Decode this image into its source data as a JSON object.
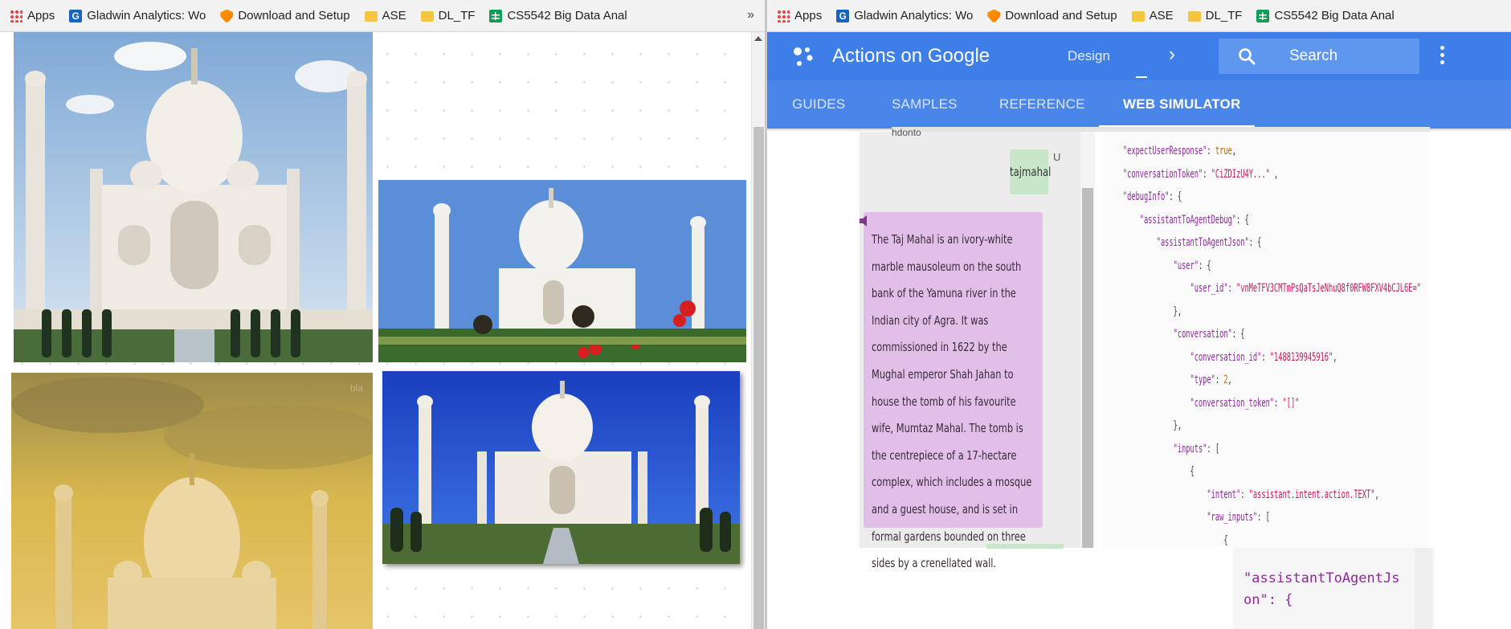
{
  "bookmarks": {
    "apps": "Apps",
    "items": [
      "Gladwin Analytics: Wo",
      "Download and Setup",
      "ASE",
      "DL_TF",
      "CS5542 Big Data Anal"
    ],
    "overflow": "»"
  },
  "left_pane": {
    "photos": [
      "Taj Mahal front view under blue sky with clouds",
      "Taj Mahal with red flowers in foreground",
      "Taj Mahal at sunset with golden sky",
      "Taj Mahal with blue sky and reflecting pool"
    ],
    "watermark": "bla"
  },
  "aog": {
    "title": "Actions on Google",
    "nav_design": "Design",
    "search_label": "Search",
    "tabs": [
      "GUIDES",
      "SAMPLES",
      "REFERENCE",
      "WEB SIMULATOR"
    ],
    "active_tab": "WEB SIMULATOR",
    "brand_color": "#3d7ee8"
  },
  "simulator": {
    "top_cut_text": "hdonto",
    "user_message": "tajmahal",
    "user_avatar": "U",
    "response_text": "The Taj Mahal is an ivory-white marble mausoleum on the south bank of the Yamuna river in the Indian city of Agra. It was commissioned in 1622 by the Mughal emperor Shah Jahan to house the tomb of his favourite wife, Mumtaz Mahal. The tomb is the centrepiece of a 17-hectare complex, which includes a mosque and a guest house, and is set in formal gardens bounded on three sides by a crenellated wall.",
    "json_lines": [
      {
        "indent": 0,
        "key": "\"expectUserResponse\"",
        "value": "true",
        "suffix": ","
      },
      {
        "indent": 0,
        "key": "\"conversationToken\"",
        "value": "\"CiZDIzU4Y...\"",
        "suffix": " ,"
      },
      {
        "indent": 0,
        "key": "\"debugInfo\"",
        "value": "",
        "suffix": " {"
      },
      {
        "indent": 1,
        "key": "\"assistantToAgentDebug\"",
        "value": "",
        "suffix": " {"
      },
      {
        "indent": 2,
        "key": "\"assistantToAgentJson\"",
        "value": "",
        "suffix": " {"
      },
      {
        "indent": 3,
        "key": "\"user\"",
        "value": "",
        "suffix": " {"
      },
      {
        "indent": 4,
        "key": "\"user_id\"",
        "value": "\"vnMeTFV3CMTmPsQaTsJeNhuQ8f0RFW8FXV4bCJL6E=\"",
        "suffix": ""
      },
      {
        "indent": 3,
        "key": "",
        "value": "",
        "suffix": "},"
      },
      {
        "indent": 3,
        "key": "\"conversation\"",
        "value": "",
        "suffix": " {"
      },
      {
        "indent": 4,
        "key": "\"conversation_id\"",
        "value": "\"1488139945916\"",
        "suffix": ","
      },
      {
        "indent": 4,
        "key": "\"type\"",
        "value": "2",
        "suffix": ","
      },
      {
        "indent": 4,
        "key": "\"conversation_token\"",
        "value": "\"[]\"",
        "suffix": ""
      },
      {
        "indent": 3,
        "key": "",
        "value": "",
        "suffix": "},"
      },
      {
        "indent": 3,
        "key": "\"inputs\"",
        "value": "",
        "suffix": " ["
      },
      {
        "indent": 4,
        "key": "",
        "value": "",
        "suffix": "{"
      },
      {
        "indent": 5,
        "key": "\"intent\"",
        "value": "\"assistant.intent.action.TEXT\"",
        "suffix": ","
      },
      {
        "indent": 5,
        "key": "\"raw_inputs\"",
        "value": "",
        "suffix": " ["
      },
      {
        "indent": 6,
        "key": "",
        "value": "",
        "suffix": "{"
      }
    ],
    "code_snippet": "\"assistantToAgentJs\non\": {"
  }
}
